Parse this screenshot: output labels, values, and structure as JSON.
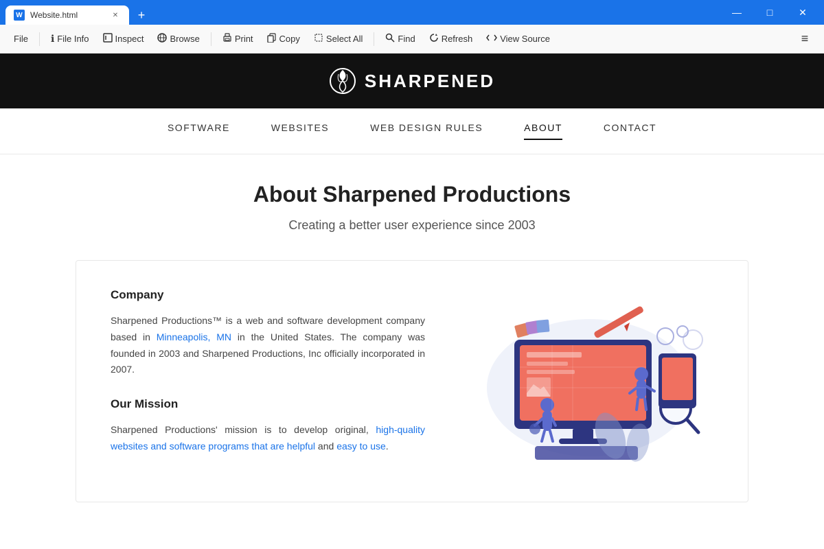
{
  "titlebar": {
    "tab_title": "Website.html",
    "new_tab_label": "+",
    "minimize": "—",
    "maximize": "□",
    "close": "✕"
  },
  "toolbar": {
    "file_label": "File",
    "fileinfo_icon": "ℹ",
    "fileinfo_label": "File Info",
    "inspect_icon": "⬜",
    "inspect_label": "Inspect",
    "browse_icon": "◎",
    "browse_label": "Browse",
    "print_icon": "🖨",
    "print_label": "Print",
    "copy_icon": "⬜",
    "copy_label": "Copy",
    "selectall_icon": "⬜",
    "selectall_label": "Select All",
    "find_icon": "🔍",
    "find_label": "Find",
    "refresh_icon": "↺",
    "refresh_label": "Refresh",
    "viewsource_icon": "⟨⟩",
    "viewsource_label": "View Source",
    "menu_icon": "≡"
  },
  "site": {
    "logo_text": "SHARPENED",
    "nav": {
      "items": [
        {
          "label": "SOFTWARE",
          "active": false
        },
        {
          "label": "WEBSITES",
          "active": false
        },
        {
          "label": "WEB DESIGN RULES",
          "active": false
        },
        {
          "label": "ABOUT",
          "active": true
        },
        {
          "label": "CONTACT",
          "active": false
        }
      ]
    },
    "page": {
      "title": "About Sharpened Productions",
      "subtitle": "Creating a better user experience since 2003",
      "company_heading": "Company",
      "company_text_1": "Sharpened Productions™ is a web and software development company based in Minneapolis, MN in the United States. The company was founded in 2003 and Sharpened Productions, Inc officially incorporated in 2007.",
      "mission_heading": "Our Mission",
      "mission_text_1": "Sharpened Productions' mission is to develop original, high-quality websites and software programs that are helpful and easy to use."
    }
  }
}
